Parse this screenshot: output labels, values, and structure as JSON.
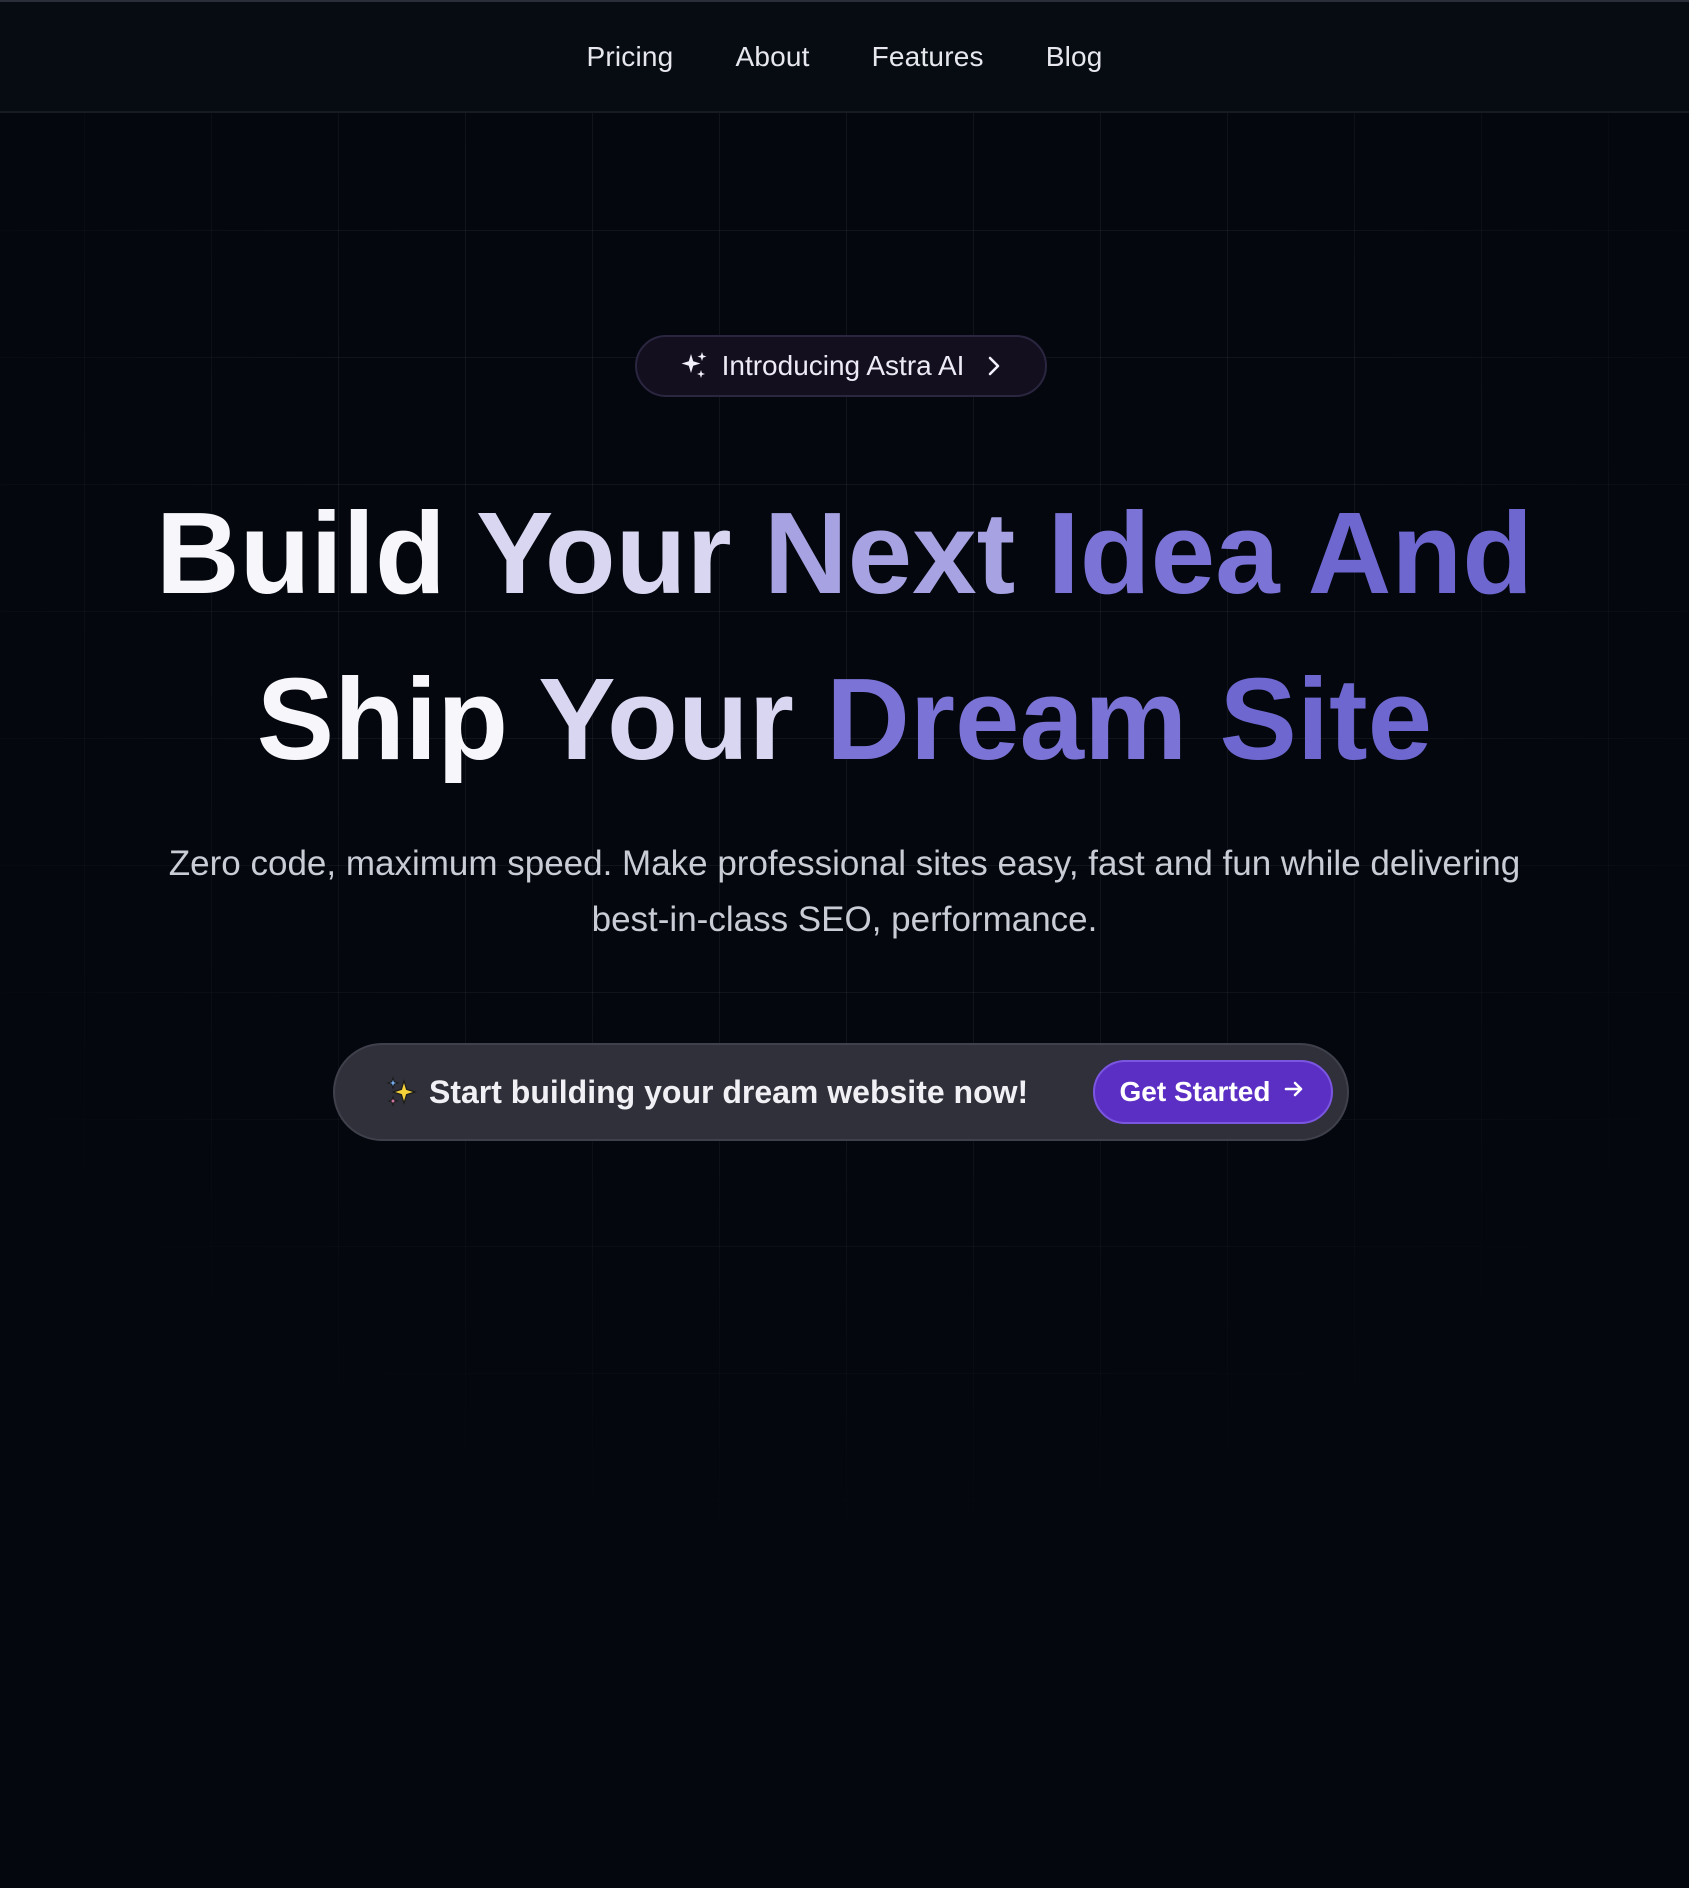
{
  "nav": {
    "items": [
      {
        "label": "Pricing"
      },
      {
        "label": "About"
      },
      {
        "label": "Features"
      },
      {
        "label": "Blog"
      }
    ]
  },
  "badge": {
    "label": "Introducing Astra AI",
    "icon": "sparkles-icon",
    "trailing_icon": "chevron-right-icon"
  },
  "headline": {
    "line1": [
      "Build",
      "Your",
      "Next",
      "Idea",
      "And"
    ],
    "line2": [
      "Ship",
      "Your",
      "Dream",
      "Site"
    ]
  },
  "subtitle": {
    "line1": "Zero code, maximum speed. Make professional sites easy, fast and fun while delivering",
    "line2": "best-in-class SEO, performance."
  },
  "cta": {
    "text": "Start building your dream website now!",
    "icon": "sparkles-emoji-icon",
    "button_label": "Get Started",
    "button_icon": "arrow-right-icon"
  },
  "colors": {
    "background": "#04070e",
    "accent": "#5b2fc4",
    "headline_purple": "#7b74d6"
  }
}
